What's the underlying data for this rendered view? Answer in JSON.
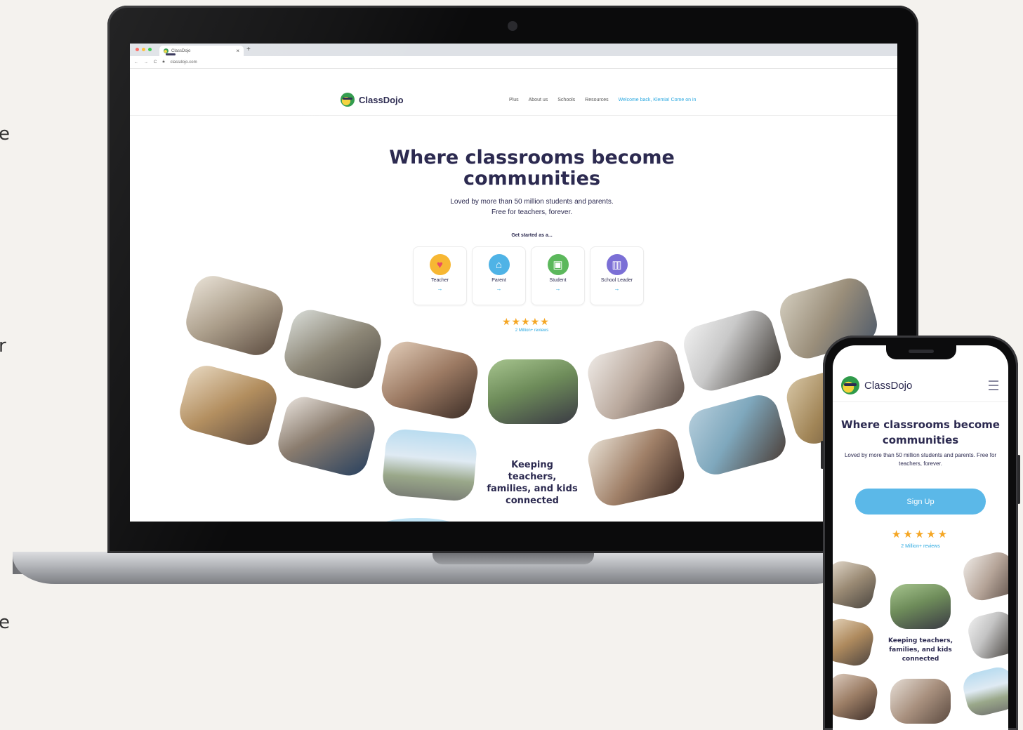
{
  "side_fragments": [
    "e",
    "r",
    "e"
  ],
  "browser": {
    "tab_title": "ClassDojo",
    "tab_close": "×",
    "new_tab": "+",
    "nav_back": "←",
    "nav_forward": "→",
    "reload": "C",
    "url": "classdojo.com"
  },
  "site": {
    "brand": "ClassDojo",
    "nav": {
      "plus": "Plus",
      "about": "About us",
      "schools": "Schools",
      "resources": "Resources",
      "welcome": "Welcome back, Klemia! Come on in"
    },
    "hero_title": "Where classrooms become communities",
    "hero_sub_line1": "Loved by more than 50 million students and parents.",
    "hero_sub_line2": "Free for teachers, forever.",
    "get_started": "Get started as a...",
    "roles": [
      {
        "label": "Teacher",
        "icon": "heart-icon",
        "color": "#f7b733",
        "glyph": "♥",
        "arrow": "→"
      },
      {
        "label": "Parent",
        "icon": "house-icon",
        "color": "#4fb3e6",
        "glyph": "⌂",
        "arrow": "→"
      },
      {
        "label": "Student",
        "icon": "backpack-icon",
        "color": "#5cb85c",
        "glyph": "▣",
        "arrow": "→"
      },
      {
        "label": "School Leader",
        "icon": "school-icon",
        "color": "#7b6fd6",
        "glyph": "▥",
        "arrow": "→"
      }
    ],
    "stars": "★★★★★",
    "reviews": "2 Million+ reviews",
    "keeping": "Keeping teachers, families, and kids connected"
  },
  "phone": {
    "brand": "ClassDojo",
    "hero_title": "Where classrooms become communities",
    "hero_sub": "Loved by more than 50 million students and parents. Free for teachers, forever.",
    "signup": "Sign Up",
    "stars": "★★★★★",
    "reviews": "2 Million+ reviews",
    "keeping": "Keeping teachers, families, and kids connected"
  },
  "colors": {
    "navy": "#2c2a50",
    "accent_blue": "#2aa8e0",
    "signup_blue": "#5bb8e8",
    "star_gold": "#f5a623",
    "background": "#f4f2ee"
  }
}
